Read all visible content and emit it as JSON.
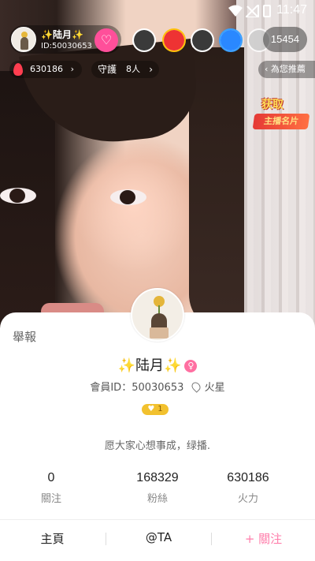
{
  "status_bar": {
    "time": "11:47"
  },
  "host": {
    "name": "✨陆月✨",
    "id_text": "ID:50030653"
  },
  "viewer_count": "15454",
  "fire_value": "630186",
  "guard": {
    "label": "守護",
    "count": "8人"
  },
  "recommend_label": "為您推薦",
  "event_badge": {
    "line1": "获取",
    "line2": "主播名片"
  },
  "card": {
    "report_label": "舉報",
    "name_prefix": "✨",
    "name": "陆月",
    "name_suffix": "✨",
    "member_id": "會員ID：50030653",
    "location": "火星",
    "level": "1",
    "signature": "愿大家心想事成，绿播.",
    "stats": [
      {
        "value": "0",
        "label": "關注"
      },
      {
        "value": "168329",
        "label": "粉絲"
      },
      {
        "value": "630186",
        "label": "火力"
      }
    ],
    "actions": {
      "home": "主頁",
      "mention": "@TA",
      "follow": "+ 關注"
    }
  },
  "colors": {
    "accent_pink": "#ff7eab",
    "badge_gold": "#f2c12e",
    "fire_red": "#ff3e50"
  }
}
